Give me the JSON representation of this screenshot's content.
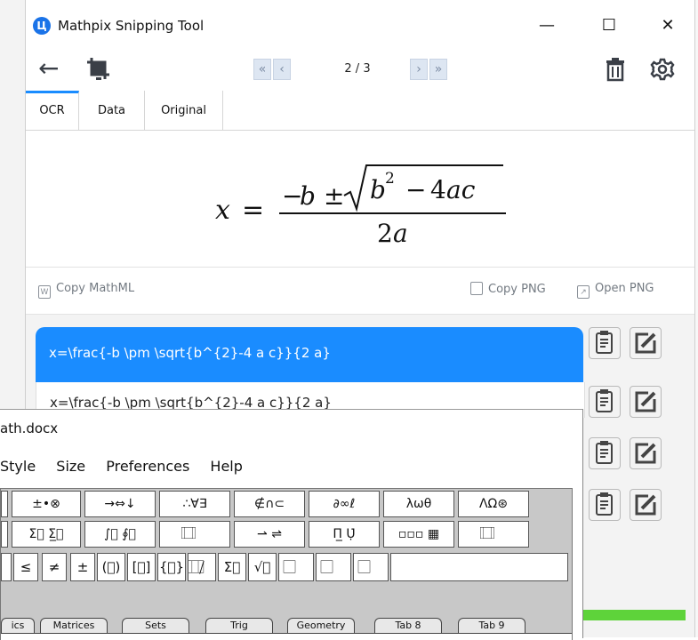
{
  "mathpix": {
    "title": "Mathpix Snipping Tool",
    "app_icon_glyph": "Ц",
    "window_controls": {
      "minimize": "—",
      "maximize": "☐",
      "close": "✕"
    },
    "toolbar": {
      "back_icon": "←",
      "page_indicator": "2 / 3",
      "first_glyph": "«",
      "prev_glyph": "‹",
      "next_glyph": "›",
      "last_glyph": "»"
    },
    "tabs": [
      {
        "label": "OCR",
        "active": true
      },
      {
        "label": "Data",
        "active": false
      },
      {
        "label": "Original",
        "active": false
      }
    ],
    "copy_mathml": "Copy MathML",
    "copy_png": "Copy PNG",
    "open_png": "Open PNG",
    "results": [
      "x=\\frac{-b \\pm \\sqrt{b^{2}-4 a c}}{2 a}",
      "x=\\frac{-b \\pm \\sqrt{b^{2}-4 a c}}{2 a}"
    ],
    "accent_color": "#1a8cff",
    "progress_color": "#5ed33a"
  },
  "mathtype": {
    "title": "ath.docx",
    "menu": [
      "Style",
      "Size",
      "Preferences",
      "Help"
    ],
    "palette_row1": [
      "±•⊗",
      "→⇔↓",
      "∴∀∃",
      "∉∩⊂",
      "∂∞ℓ",
      "λωθ",
      "ΛΩ⊛"
    ],
    "palette_row2": [
      "Σ⃞ Σ̲⃞",
      "∫⃞ ∮⃞",
      "⃞ ⃞",
      "⇀ ⇌",
      "Π̲ Ụ̇",
      "▫▫▫ ▦",
      "⃞ ⃞"
    ],
    "palette_row3": [
      "≤",
      "≠",
      "±",
      "(⃞)",
      "[⃞]",
      "{⃞}",
      "⃞/⃞",
      "Σ⃞",
      "√⃞",
      "⃞",
      "⃞",
      "⃞"
    ],
    "tab_labels": [
      "ics",
      "Matrices",
      "Sets",
      "Trig",
      "Geometry",
      "Tab 8",
      "Tab 9"
    ]
  }
}
